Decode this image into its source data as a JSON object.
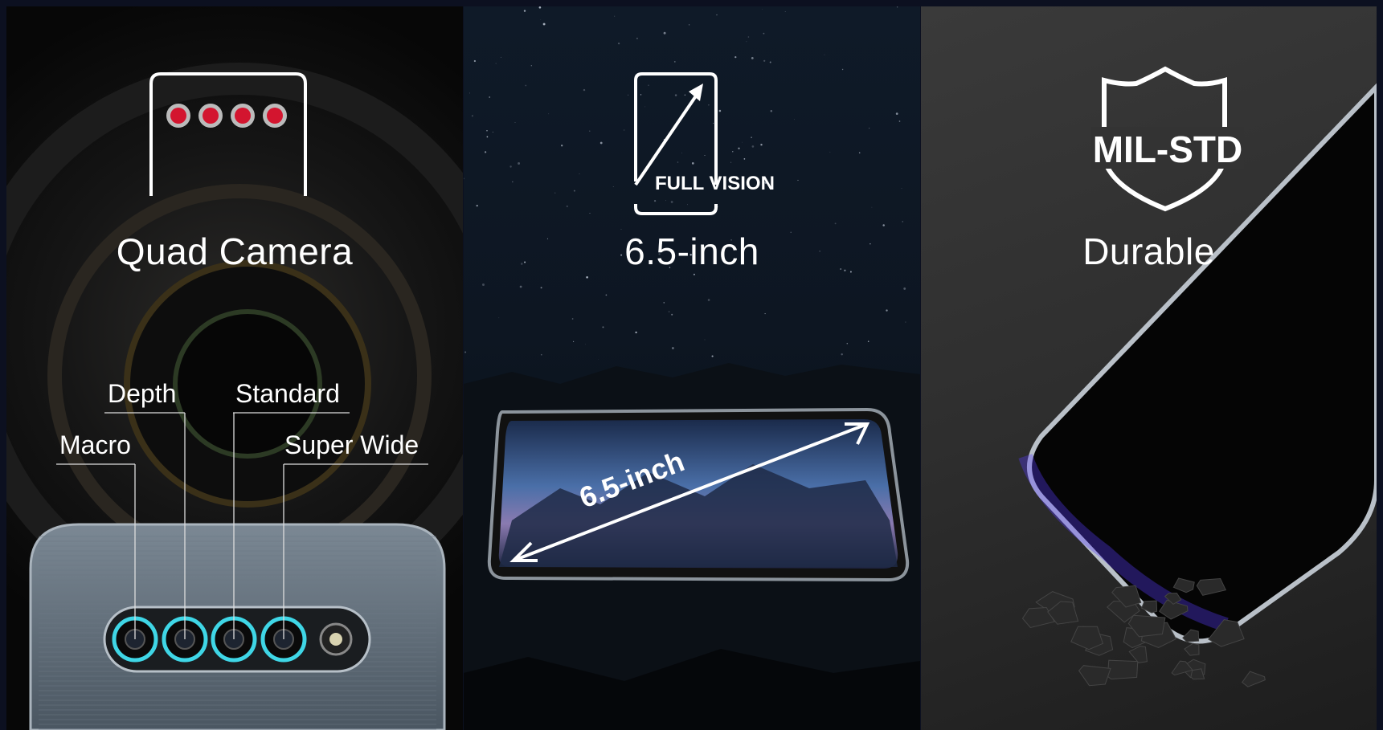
{
  "panels": [
    {
      "title": "Quad Camera",
      "icon": "quad-camera-icon",
      "lenses": [
        "Macro",
        "Depth",
        "Standard",
        "Super Wide"
      ],
      "accent": "#d3152f",
      "ring_color": "#3fd6e6"
    },
    {
      "title": "6.5-inch",
      "icon": "full-vision-icon",
      "icon_text": "FULL VISION",
      "screen_label": "6.5-inch"
    },
    {
      "title": "Durable",
      "icon": "mil-std-shield-icon",
      "icon_text": "MIL-STD",
      "glow": "#5a3cff"
    }
  ]
}
